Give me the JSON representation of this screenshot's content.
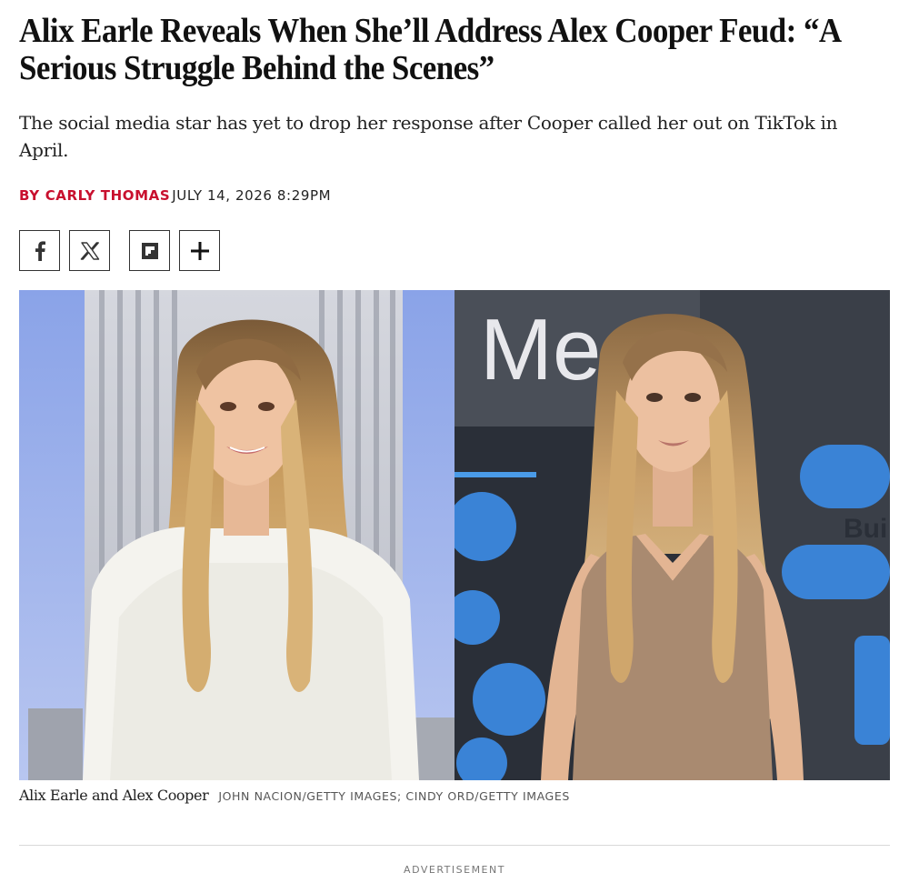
{
  "article": {
    "headline": "Alix Earle Reveals When She’ll Address Alex Cooper Feud: “A Serious Struggle Behind the Scenes”",
    "dek": "The social media star has yet to drop her response after Cooper called her out on TikTok in April.",
    "byline": {
      "prefix": "BY",
      "author": "CARLY THOMAS",
      "date": "JULY 14, 2026 8:29PM"
    }
  },
  "share": {
    "buttons": [
      {
        "icon": "facebook-icon",
        "label": "f"
      },
      {
        "icon": "x-icon",
        "label": "𝕏"
      },
      {
        "icon": "flipboard-icon"
      },
      {
        "icon": "plus-icon",
        "label": "+"
      }
    ]
  },
  "hero": {
    "left_sign_text": "",
    "right_sign_text": "Me",
    "right_sign_text2": "Bui",
    "caption": "Alix Earle and Alex Cooper",
    "credit": "JOHN NACION/GETTY IMAGES; CINDY ORD/GETTY IMAGES"
  },
  "ad": {
    "label": "ADVERTISEMENT"
  },
  "colors": {
    "accent": "#c8102e",
    "text": "#111111",
    "divider": "#d8d8d8"
  }
}
